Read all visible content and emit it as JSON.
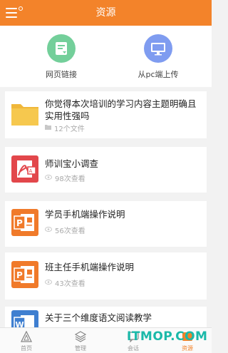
{
  "header": {
    "title": "资源"
  },
  "upload": {
    "web_label": "网页链接",
    "pc_label": "从pc端上传"
  },
  "items": [
    {
      "title": "你觉得本次培训的学习内容主题明确且实用性强吗",
      "meta": "12个文件",
      "icon": "folder-icon",
      "color": "#f5c244"
    },
    {
      "title": "师训宝小调查",
      "meta": "98次查看",
      "icon": "pdf-icon",
      "color": "#e2474b"
    },
    {
      "title": "学员手机端操作说明",
      "meta": "56次查看",
      "icon": "ppt-icon",
      "color": "#f07a2a"
    },
    {
      "title": "班主任手机端操作说明",
      "meta": "43次查看",
      "icon": "ppt-icon",
      "color": "#f07a2a"
    },
    {
      "title": "关于三个维度语文阅读教学",
      "meta": "",
      "icon": "word-icon",
      "color": "#3f7fd0"
    }
  ],
  "tabs": [
    {
      "label": "首页",
      "icon": "home-icon"
    },
    {
      "label": "管理",
      "icon": "layers-icon"
    },
    {
      "label": "会话",
      "icon": "chat-icon"
    },
    {
      "label": "资源",
      "icon": "resource-icon",
      "active": true
    }
  ],
  "watermark": "ITMOP.COM",
  "colors": {
    "accent": "#f3832a",
    "watermark": "#1bb9a9"
  }
}
